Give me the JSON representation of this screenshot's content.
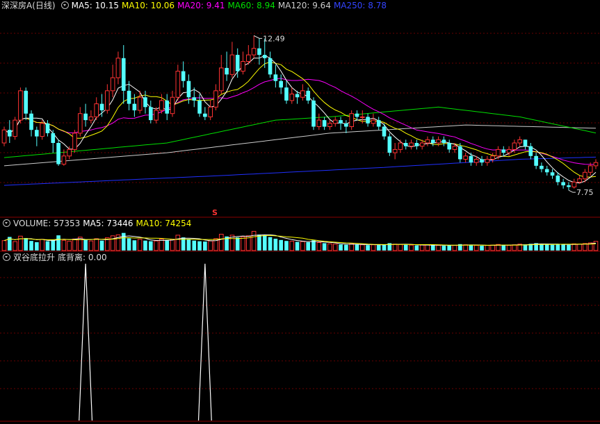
{
  "colors": {
    "up": "#ff3333",
    "down": "#54ffff",
    "ma5": "#ffffff",
    "ma10": "#ffff00",
    "ma20": "#ff00ff",
    "ma60": "#00e000",
    "ma120": "#cccccc",
    "ma250": "#2030ff",
    "grid": "#6a0000",
    "divider": "#8a0000",
    "indicator": "#ffffff"
  },
  "main_legend": {
    "stock_name": "深深房A",
    "period": "(日线)",
    "ma5_label": "MA5: 10.15",
    "ma10_label": "MA10: 10.06",
    "ma20_label": "MA20: 9.41",
    "ma60_label": "MA60: 8.94",
    "ma120_label": "MA120: 9.64",
    "ma250_label": "MA250: 8.78"
  },
  "volume_legend": {
    "volume_label": "VOLUME: 57353",
    "ma5_label": "MA5: 73446",
    "ma10_label": "MA10: 74254"
  },
  "indicator_legend": {
    "name": "双谷底拉升",
    "value_label": "底背离: 0.00"
  },
  "annotations": {
    "high": "12.49",
    "low": "7.75",
    "marker": "S"
  },
  "chart_data": [
    {
      "type": "candlestick",
      "title": "深深房A (日线)",
      "ylim": [
        7.2,
        13.2
      ],
      "candles": [
        [
          9.2,
          9.6,
          9.1,
          9.7
        ],
        [
          9.6,
          9.4,
          9.2,
          9.9
        ],
        [
          9.4,
          9.9,
          9.3,
          10.0
        ],
        [
          9.9,
          10.8,
          9.8,
          10.9
        ],
        [
          10.8,
          10.1,
          9.9,
          10.9
        ],
        [
          10.1,
          9.6,
          9.4,
          10.2
        ],
        [
          9.6,
          9.4,
          9.1,
          9.7
        ],
        [
          9.4,
          9.8,
          9.3,
          9.9
        ],
        [
          9.8,
          9.5,
          9.4,
          9.9
        ],
        [
          9.5,
          9.2,
          8.9,
          9.6
        ],
        [
          9.2,
          8.55,
          8.5,
          9.3
        ],
        [
          8.55,
          8.8,
          8.5,
          9.0
        ],
        [
          8.8,
          9.0,
          8.7,
          9.1
        ],
        [
          9.0,
          9.5,
          8.9,
          9.6
        ],
        [
          9.5,
          10.1,
          9.4,
          10.3
        ],
        [
          10.1,
          9.9,
          9.7,
          10.4
        ],
        [
          9.9,
          10.0,
          9.8,
          10.2
        ],
        [
          10.0,
          10.4,
          9.9,
          10.6
        ],
        [
          10.4,
          10.2,
          10.0,
          10.7
        ],
        [
          10.2,
          10.8,
          10.1,
          11.0
        ],
        [
          10.8,
          11.2,
          10.6,
          11.6
        ],
        [
          11.2,
          11.8,
          11.0,
          12.0
        ],
        [
          11.8,
          10.8,
          10.4,
          12.2
        ],
        [
          10.8,
          10.4,
          10.2,
          11.1
        ],
        [
          10.4,
          10.2,
          10.0,
          10.7
        ],
        [
          10.2,
          10.6,
          10.1,
          10.8
        ],
        [
          10.6,
          10.3,
          10.1,
          10.8
        ],
        [
          10.3,
          9.9,
          9.8,
          10.5
        ],
        [
          9.9,
          10.2,
          9.8,
          10.3
        ],
        [
          10.2,
          10.5,
          10.1,
          10.7
        ],
        [
          10.5,
          10.1,
          9.9,
          10.7
        ],
        [
          10.1,
          10.6,
          10.0,
          10.8
        ],
        [
          10.6,
          11.4,
          10.5,
          11.6
        ],
        [
          11.4,
          11.1,
          10.9,
          11.7
        ],
        [
          11.1,
          10.6,
          10.4,
          11.3
        ],
        [
          10.6,
          10.5,
          10.3,
          10.9
        ],
        [
          10.5,
          10.1,
          10.0,
          10.7
        ],
        [
          10.1,
          10.0,
          9.9,
          10.3
        ],
        [
          10.0,
          10.3,
          9.9,
          10.5
        ],
        [
          10.3,
          10.8,
          10.2,
          11.0
        ],
        [
          10.8,
          11.5,
          10.7,
          11.9
        ],
        [
          11.5,
          11.3,
          11.1,
          12.0
        ],
        [
          11.3,
          11.9,
          11.2,
          12.3
        ],
        [
          11.9,
          11.4,
          11.2,
          12.1
        ],
        [
          11.4,
          11.7,
          11.3,
          12.0
        ],
        [
          11.7,
          11.9,
          11.6,
          12.2
        ],
        [
          11.9,
          12.1,
          11.8,
          12.49
        ],
        [
          12.1,
          11.9,
          11.6,
          12.4
        ],
        [
          11.9,
          11.8,
          11.5,
          12.4
        ],
        [
          11.8,
          11.3,
          11.2,
          12.0
        ],
        [
          11.3,
          11.1,
          10.9,
          11.6
        ],
        [
          11.1,
          10.9,
          10.7,
          11.3
        ],
        [
          10.9,
          10.5,
          10.4,
          11.1
        ],
        [
          10.5,
          10.7,
          10.4,
          10.9
        ],
        [
          10.7,
          10.6,
          10.4,
          10.8
        ],
        [
          10.6,
          10.8,
          10.5,
          11.0
        ],
        [
          10.8,
          10.5,
          10.4,
          10.9
        ],
        [
          10.5,
          9.7,
          9.6,
          10.6
        ],
        [
          9.7,
          9.9,
          9.6,
          10.1
        ],
        [
          9.9,
          9.7,
          9.6,
          10.0
        ],
        [
          9.7,
          9.8,
          9.6,
          9.9
        ],
        [
          9.8,
          9.9,
          9.7,
          10.0
        ],
        [
          9.9,
          9.8,
          9.6,
          10.0
        ],
        [
          9.8,
          9.7,
          9.5,
          9.9
        ],
        [
          9.7,
          10.1,
          9.6,
          10.2
        ],
        [
          10.1,
          10.0,
          9.9,
          10.2
        ],
        [
          10.0,
          10.0,
          9.8,
          10.2
        ],
        [
          10.0,
          9.8,
          9.7,
          10.1
        ],
        [
          9.8,
          9.9,
          9.7,
          10.1
        ],
        [
          9.9,
          9.7,
          9.6,
          10.0
        ],
        [
          9.7,
          9.4,
          9.3,
          9.8
        ],
        [
          9.4,
          8.9,
          8.8,
          9.5
        ],
        [
          8.9,
          9.0,
          8.7,
          9.2
        ],
        [
          9.0,
          9.2,
          8.9,
          9.3
        ],
        [
          9.2,
          9.1,
          9.0,
          9.3
        ],
        [
          9.1,
          9.2,
          9.0,
          9.3
        ],
        [
          9.2,
          9.1,
          9.0,
          9.3
        ],
        [
          9.1,
          9.2,
          9.0,
          9.3
        ],
        [
          9.2,
          9.3,
          9.1,
          9.4
        ],
        [
          9.3,
          9.2,
          9.1,
          9.4
        ],
        [
          9.2,
          9.3,
          9.1,
          9.4
        ],
        [
          9.3,
          9.2,
          9.1,
          9.4
        ],
        [
          9.2,
          9.0,
          8.9,
          9.3
        ],
        [
          9.0,
          9.1,
          8.9,
          9.2
        ],
        [
          9.1,
          8.7,
          8.6,
          9.2
        ],
        [
          8.7,
          8.8,
          8.6,
          8.9
        ],
        [
          8.8,
          8.6,
          8.5,
          8.9
        ],
        [
          8.6,
          8.7,
          8.5,
          8.8
        ],
        [
          8.7,
          8.6,
          8.5,
          8.8
        ],
        [
          8.6,
          8.7,
          8.5,
          8.8
        ],
        [
          8.7,
          8.8,
          8.6,
          8.9
        ],
        [
          8.8,
          9.0,
          8.7,
          9.1
        ],
        [
          9.0,
          8.9,
          8.8,
          9.1
        ],
        [
          8.9,
          9.0,
          8.8,
          9.1
        ],
        [
          9.0,
          9.2,
          8.9,
          9.3
        ],
        [
          9.2,
          9.3,
          9.1,
          9.4
        ],
        [
          9.3,
          9.1,
          9.0,
          9.3
        ],
        [
          9.1,
          8.8,
          8.7,
          9.2
        ],
        [
          8.8,
          8.5,
          8.4,
          8.9
        ],
        [
          8.5,
          8.4,
          8.3,
          8.6
        ],
        [
          8.4,
          8.3,
          8.2,
          8.5
        ],
        [
          8.3,
          8.2,
          8.1,
          8.4
        ],
        [
          8.2,
          8.0,
          7.9,
          8.3
        ],
        [
          8.0,
          7.9,
          7.8,
          8.1
        ],
        [
          7.9,
          7.85,
          7.75,
          8.0
        ],
        [
          7.85,
          8.0,
          7.8,
          8.1
        ],
        [
          8.0,
          8.1,
          7.95,
          8.2
        ],
        [
          8.1,
          8.3,
          8.0,
          8.4
        ],
        [
          8.3,
          8.5,
          8.2,
          8.6
        ],
        [
          8.5,
          8.6,
          8.4,
          8.7
        ]
      ],
      "ma5_end": 10.15,
      "ma10_end": 10.06,
      "ma20_end": 9.41,
      "ma60_end": 8.94,
      "ma120_end": 9.64,
      "ma250_end": 8.78,
      "ma60": [
        [
          0,
          8.75
        ],
        [
          30,
          9.2
        ],
        [
          50,
          9.9
        ],
        [
          60,
          10.0
        ],
        [
          80,
          10.3
        ],
        [
          95,
          10.0
        ],
        [
          112,
          9.4
        ]
      ],
      "ma120": [
        [
          0,
          8.5
        ],
        [
          30,
          8.9
        ],
        [
          60,
          9.5
        ],
        [
          85,
          9.75
        ],
        [
          112,
          9.64
        ]
      ],
      "ma250": [
        [
          0,
          7.9
        ],
        [
          40,
          8.2
        ],
        [
          70,
          8.45
        ],
        [
          95,
          8.7
        ],
        [
          112,
          8.78
        ]
      ]
    },
    {
      "type": "bar",
      "title": "VOLUME",
      "values": [
        62000,
        85000,
        56000,
        90000,
        78000,
        60000,
        52000,
        70000,
        58000,
        66000,
        95000,
        64000,
        58000,
        72000,
        84000,
        68000,
        60000,
        74000,
        62000,
        80000,
        92000,
        98000,
        110000,
        76000,
        64000,
        70000,
        62000,
        58000,
        60000,
        72000,
        66000,
        70000,
        96000,
        82000,
        70000,
        62000,
        58000,
        56000,
        60000,
        74000,
        102000,
        88000,
        96000,
        82000,
        86000,
        92000,
        120000,
        100000,
        96000,
        84000,
        74000,
        66000,
        60000,
        58000,
        54000,
        56000,
        52000,
        64000,
        50000,
        46000,
        42000,
        40000,
        38000,
        36000,
        42000,
        38000,
        36000,
        34000,
        36000,
        34000,
        38000,
        46000,
        40000,
        38000,
        36000,
        34000,
        32000,
        34000,
        36000,
        34000,
        32000,
        30000,
        34000,
        32000,
        40000,
        36000,
        34000,
        32000,
        30000,
        32000,
        34000,
        38000,
        34000,
        32000,
        36000,
        40000,
        38000,
        42000,
        46000,
        40000,
        38000,
        36000,
        40000,
        38000,
        36000,
        42000,
        40000,
        44000,
        48000,
        57353
      ],
      "ma5_end": 73446,
      "ma10_end": 74254
    },
    {
      "type": "line",
      "title": "双谷底拉升 底背离",
      "spikes": [
        {
          "index": 15,
          "value": 1
        },
        {
          "index": 37,
          "value": 1
        }
      ],
      "value_end": 0.0
    }
  ]
}
